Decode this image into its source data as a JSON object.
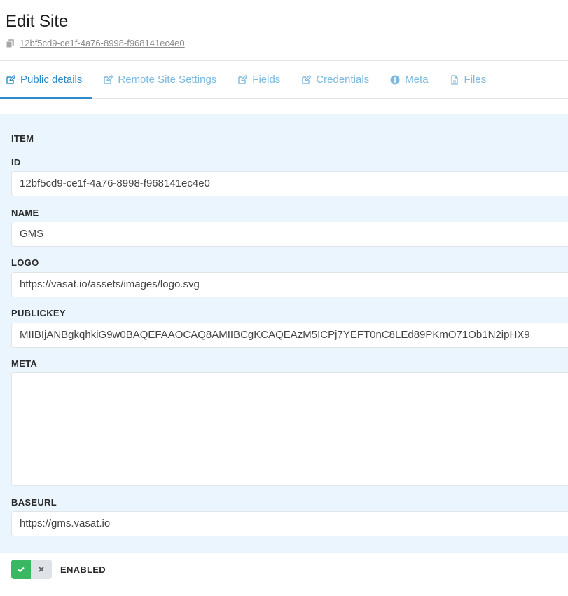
{
  "page": {
    "title": "Edit Site",
    "uuid": "12bf5cd9-ce1f-4a76-8998-f968141ec4e0"
  },
  "tabs": [
    {
      "label": "Public details",
      "icon": "edit-icon",
      "active": true
    },
    {
      "label": "Remote Site Settings",
      "icon": "edit-icon",
      "active": false
    },
    {
      "label": "Fields",
      "icon": "edit-icon",
      "active": false
    },
    {
      "label": "Credentials",
      "icon": "edit-icon",
      "active": false
    },
    {
      "label": "Meta",
      "icon": "info-icon",
      "active": false
    },
    {
      "label": "Files",
      "icon": "file-icon",
      "active": false
    }
  ],
  "form": {
    "section": "ITEM",
    "id_label": "ID",
    "id_value": "12bf5cd9-ce1f-4a76-8998-f968141ec4e0",
    "name_label": "NAME",
    "name_value": "GMS",
    "logo_label": "LOGO",
    "logo_value": "https://vasat.io/assets/images/logo.svg",
    "publickey_label": "PUBLICKEY",
    "publickey_value": "MIIBIjANBgkqhkiG9w0BAQEFAAOCAQ8AMIIBCgKCAQEAzM5ICPj7YEFT0nC8LEd89PKmO71Ob1N2ipHX9",
    "meta_label": "META",
    "meta_value": "",
    "baseurl_label": "BASEURL",
    "baseurl_value": "https://gms.vasat.io"
  },
  "enabled": {
    "label": "ENABLED",
    "value": true
  },
  "colors": {
    "accent": "#2e8bc9",
    "tab_inactive": "#7cb9de",
    "panel_bg": "#eaf5fd",
    "toggle_on": "#3ab761",
    "toggle_off": "#dfe2e6"
  }
}
